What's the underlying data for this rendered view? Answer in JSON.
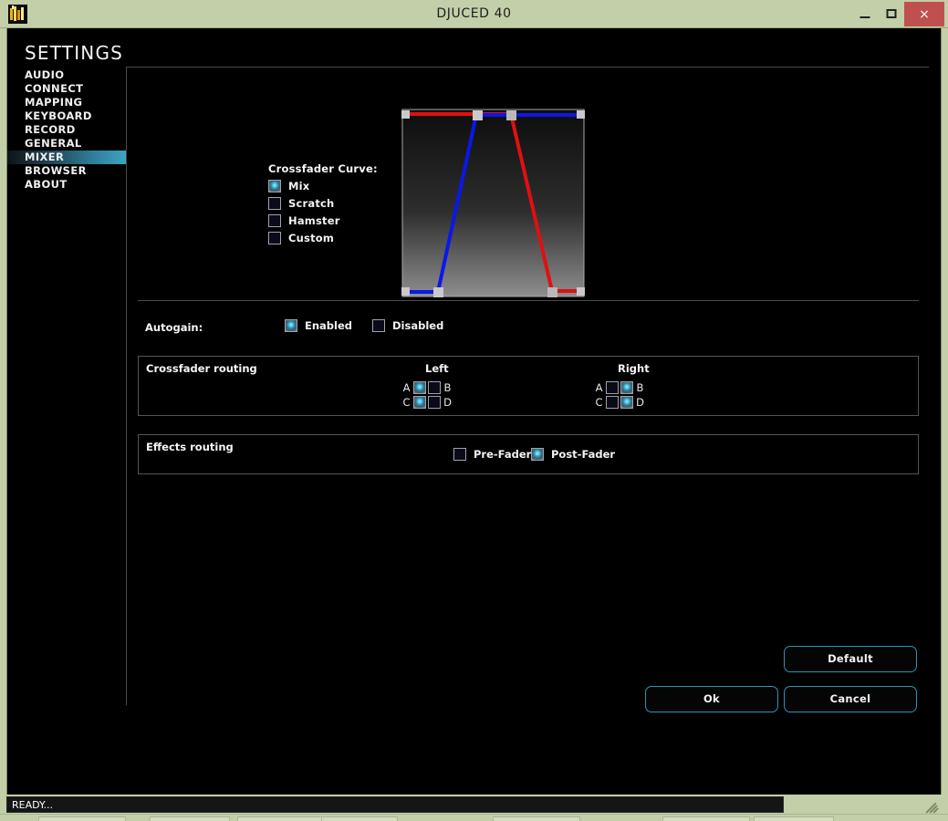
{
  "window": {
    "title": "DJUCED 40",
    "icon": "djuced-app-icon",
    "controls": {
      "minimize": "minimize-icon",
      "maximize": "maximize-icon",
      "close": "close-icon",
      "close_glyph": "×"
    }
  },
  "sidebar": {
    "heading": "SETTINGS",
    "items": [
      {
        "label": "AUDIO",
        "active": false
      },
      {
        "label": "CONNECT",
        "active": false
      },
      {
        "label": "MAPPING",
        "active": false
      },
      {
        "label": "KEYBOARD",
        "active": false
      },
      {
        "label": "RECORD",
        "active": false
      },
      {
        "label": "GENERAL",
        "active": false
      },
      {
        "label": "MIXER",
        "active": true
      },
      {
        "label": "BROWSER",
        "active": false
      },
      {
        "label": "ABOUT",
        "active": false
      }
    ]
  },
  "crossfader_curve": {
    "label": "Crossfader Curve:",
    "options": [
      {
        "label": "Mix",
        "checked": true
      },
      {
        "label": "Scratch",
        "checked": false
      },
      {
        "label": "Hamster",
        "checked": false
      },
      {
        "label": "Custom",
        "checked": false
      }
    ],
    "graph": {
      "left_channel_color": "#0a18e8",
      "right_channel_color": "#e01010",
      "handle_color": "#cdcdcd",
      "background_top": "#0d0d0d",
      "background_bottom": "#8a8a8a"
    }
  },
  "autogain": {
    "label": "Autogain:",
    "options": [
      {
        "label": "Enabled",
        "checked": true
      },
      {
        "label": "Disabled",
        "checked": false
      }
    ]
  },
  "crossfader_routing": {
    "title": "Crossfader routing",
    "left_header": "Left",
    "right_header": "Right",
    "left": {
      "row1": {
        "tag_a": "A",
        "a_checked": true,
        "b_checked": false,
        "tag_b": "B"
      },
      "row2": {
        "tag_c": "C",
        "c_checked": true,
        "d_checked": false,
        "tag_d": "D"
      }
    },
    "right": {
      "row1": {
        "tag_a": "A",
        "a_checked": false,
        "b_checked": true,
        "tag_b": "B"
      },
      "row2": {
        "tag_c": "C",
        "c_checked": false,
        "d_checked": true,
        "tag_d": "D"
      }
    }
  },
  "effects_routing": {
    "title": "Effects routing",
    "options": [
      {
        "label": "Pre-Fader",
        "checked": false
      },
      {
        "label": "Post-Fader",
        "checked": true
      }
    ]
  },
  "actions": {
    "default": "Default",
    "ok": "Ok",
    "cancel": "Cancel"
  },
  "statusbar": {
    "text": "READY...",
    "grip": "resize-grip-icon"
  },
  "colors": {
    "accent": "#2a94b4",
    "titlebar": "#c3cfa8",
    "close_button": "#c05050",
    "nav_active_end": "#3da3c2",
    "checkbox_on": "#55c8e8"
  }
}
